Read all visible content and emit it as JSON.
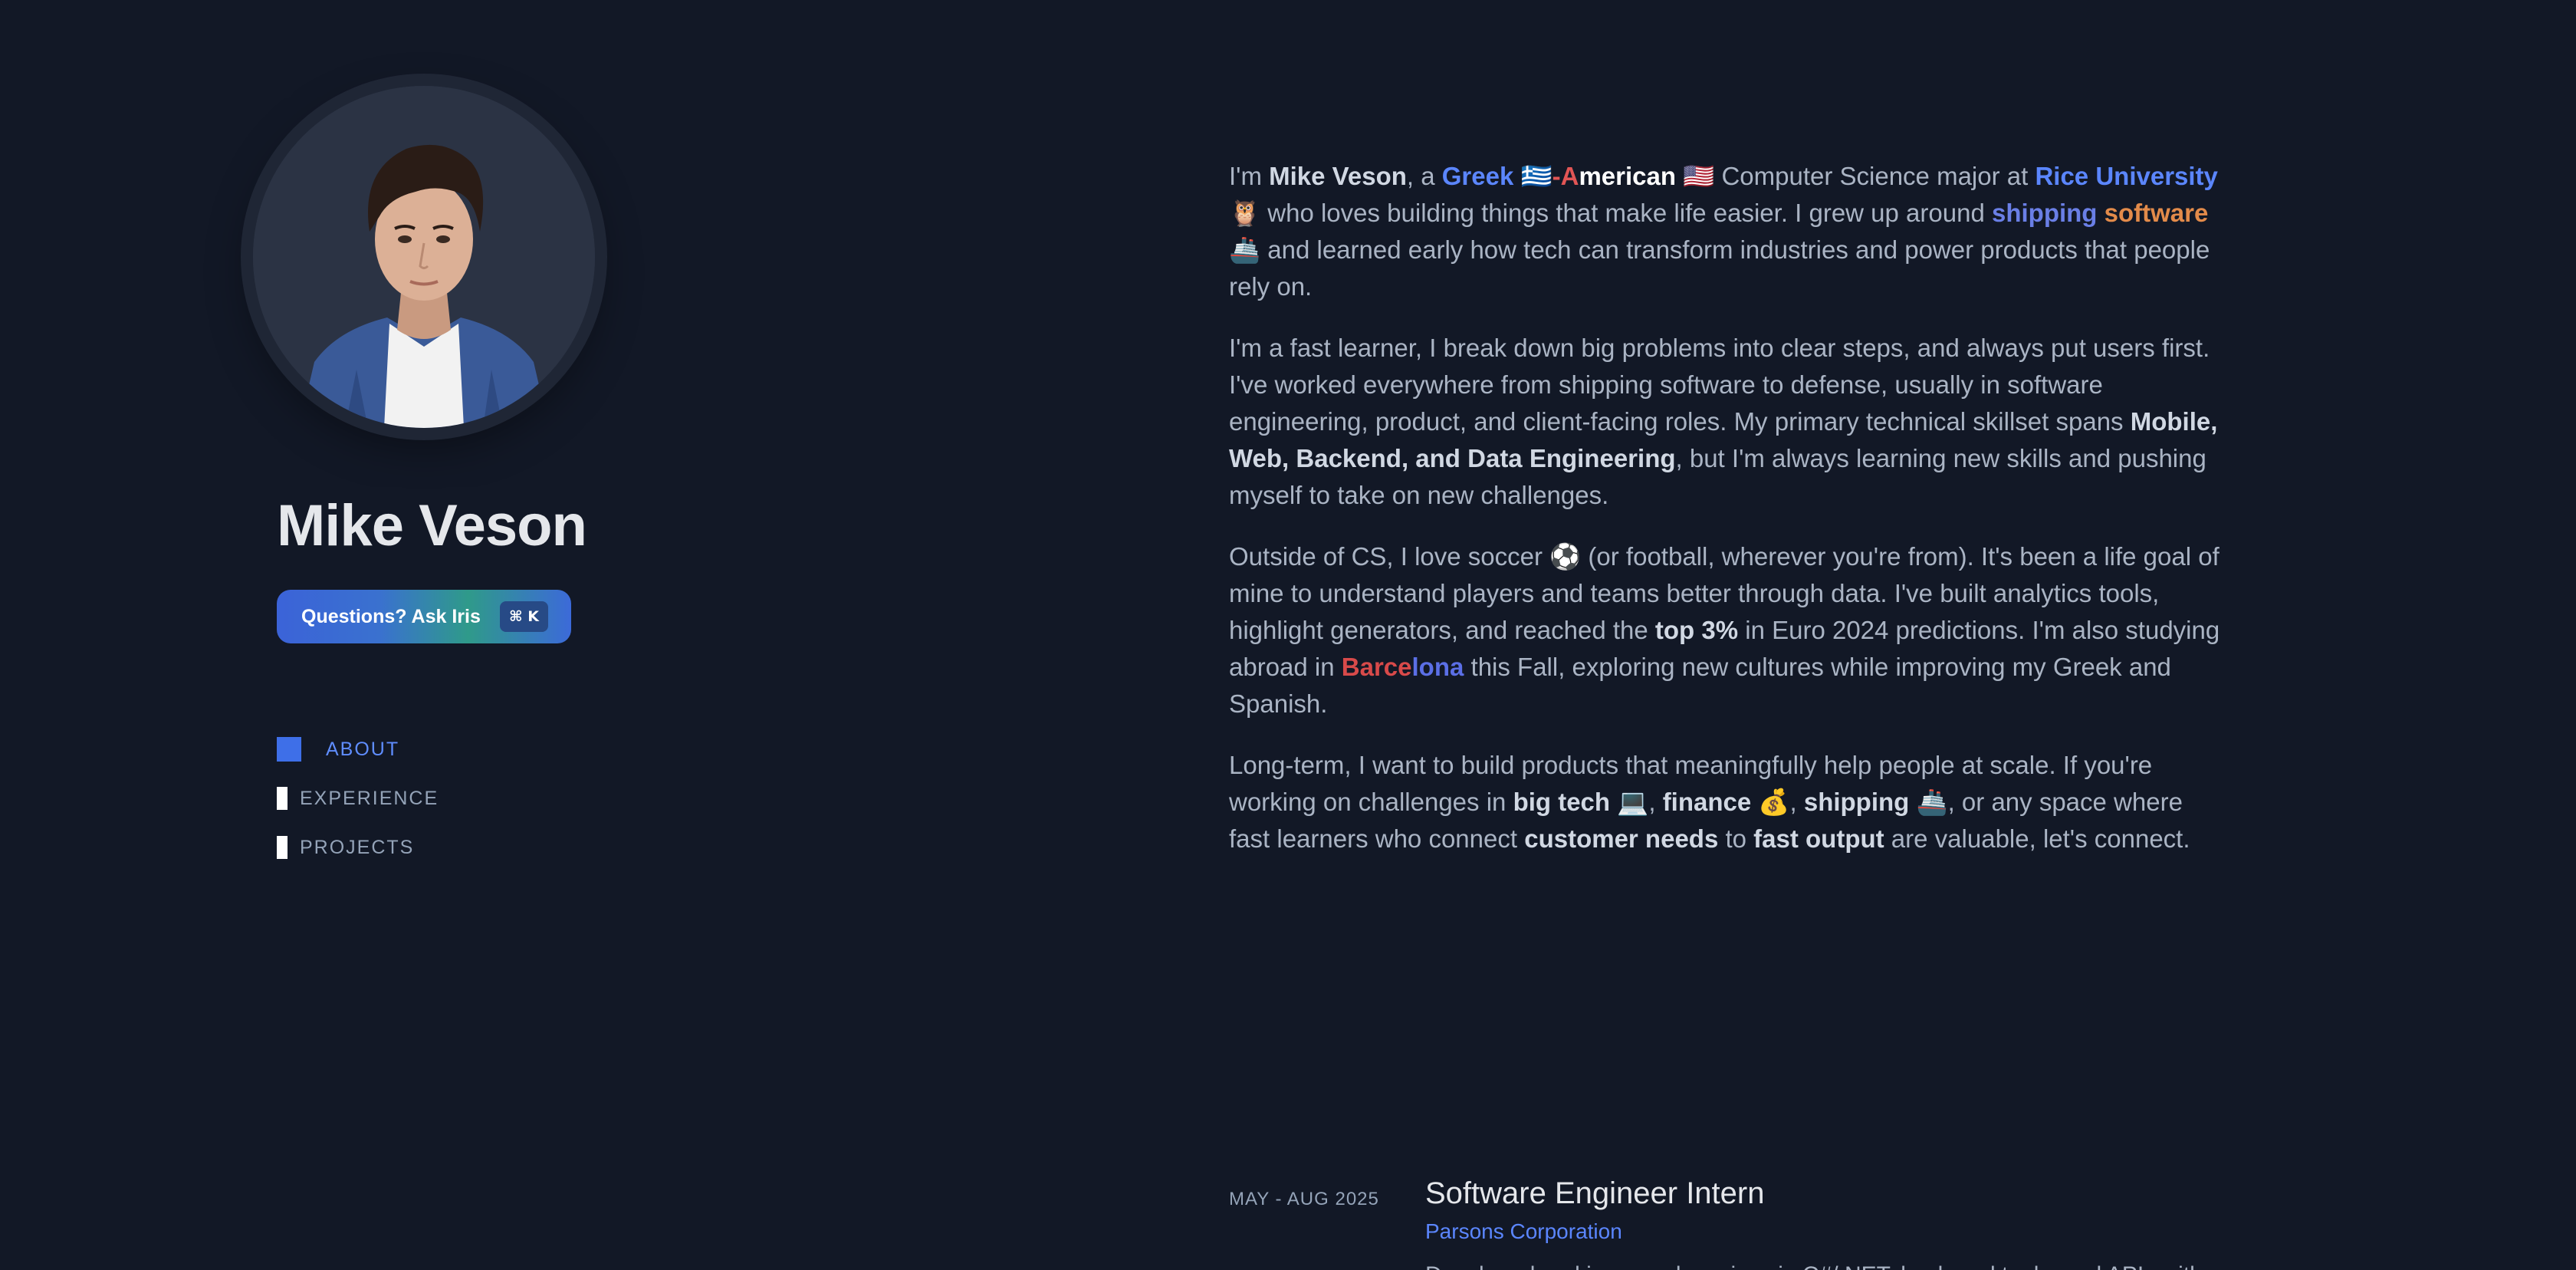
{
  "profile": {
    "name": "Mike Veson"
  },
  "ask_button": {
    "label": "Questions? Ask Iris",
    "shortcut": "⌘ K"
  },
  "nav": {
    "items": [
      {
        "label": "ABOUT",
        "active": true
      },
      {
        "label": "EXPERIENCE",
        "active": false
      },
      {
        "label": "PROJECTS",
        "active": false
      }
    ]
  },
  "about": {
    "p1": {
      "t1": "I'm ",
      "name": "Mike Veson",
      "t2": ", a ",
      "greek": "Greek",
      "flag_gr": "🇬🇷",
      "dash": "-",
      "am_first": "A",
      "am_rest": "merican",
      "flag_us": "🇺🇸",
      "t3": " Computer Science major at ",
      "rice": "Rice University",
      "owl": "🦉",
      "t4": " who loves building things that make life easier. I grew up around ",
      "ship1": "shipping",
      "ship2": " software",
      "ship_emoji": "🚢",
      "t5": " and learned early how tech can transform industries and power products that people rely on."
    },
    "p2": {
      "t1": "I'm a fast learner, I break down big problems into clear steps, and always put users first. I've worked everywhere from shipping software to defense, usually in software engineering, product, and client-facing roles. My primary technical skillset spans ",
      "skills": "Mobile, Web, Backend, and Data Engineering",
      "t2": ", but I'm always learning new skills and pushing myself to take on new challenges."
    },
    "p3": {
      "t1": "Outside of CS, I love soccer ",
      "ball": "⚽",
      "t2": " (or football, wherever you're from). It's been a life goal of mine to understand players and teams better through data. I've built analytics tools, highlight generators, and reached the ",
      "top": "top 3%",
      "t3": " in Euro 2024 predictions. I'm also studying abroad in ",
      "barca1": "Barce",
      "barca2": "lona",
      "t4": " this Fall, exploring new cultures while improving my Greek and Spanish."
    },
    "p4": {
      "t1": "Long-term, I want to build products that meaningfully help people at scale. If you're working on challenges in ",
      "bigtech": "big tech",
      "computer": "💻",
      "c1": ", ",
      "finance": "finance",
      "money": "💰",
      "c2": ", ",
      "shipping": "shipping",
      "ship": "🚢",
      "t2": ", or any space where fast learners who connect ",
      "needs": "customer needs",
      "t3": " to ",
      "output": "fast output",
      "t4": " are valuable, let's connect."
    }
  },
  "experience": {
    "date": "MAY - AUG 2025",
    "title": "Software Engineer Intern",
    "company": "Parsons Corporation",
    "desc": "Developed and improved services in C#/.NET, back-end tools, and APIs with"
  },
  "colors": {
    "background": "#121826",
    "accent": "#3e6fe8",
    "link": "#5b86ff"
  }
}
